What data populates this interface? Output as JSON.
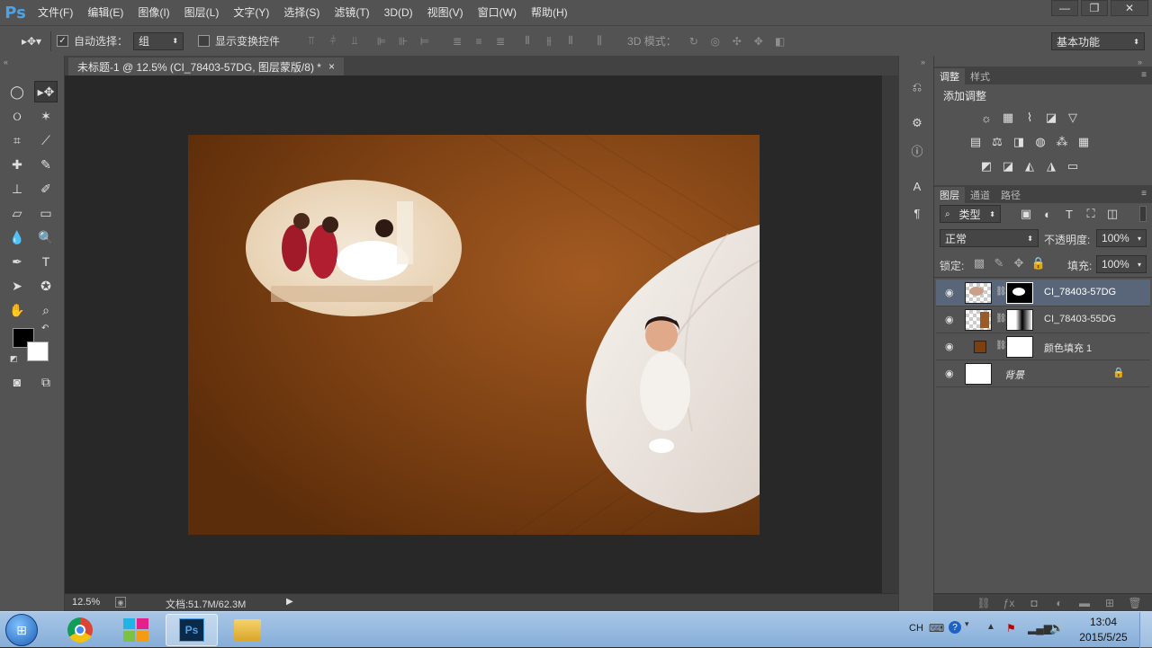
{
  "app": {
    "logo": "Ps"
  },
  "menu": [
    "文件(F)",
    "编辑(E)",
    "图像(I)",
    "图层(L)",
    "文字(Y)",
    "选择(S)",
    "滤镜(T)",
    "3D(D)",
    "视图(V)",
    "窗口(W)",
    "帮助(H)"
  ],
  "window_controls": {
    "minimize": "—",
    "restore": "❐",
    "close": "✕"
  },
  "options": {
    "auto_select_label": "自动选择：",
    "auto_select_value": "组",
    "show_transform_label": "显示变换控件",
    "mode_3d_label": "3D 模式：",
    "workspace": "基本功能"
  },
  "document": {
    "tab_title": "未标题-1 @ 12.5% (CI_78403-57DG, 图层蒙版/8) *",
    "tab_close": "×",
    "canvas_color": "#6e3a10"
  },
  "status": {
    "zoom": "12.5%",
    "doc_size": "文档:51.7M/62.3M"
  },
  "adjust_panel": {
    "tabs": [
      "调整",
      "样式"
    ],
    "title": "添加调整"
  },
  "layers_panel": {
    "tabs": [
      "图层",
      "通道",
      "路径"
    ],
    "filter_kind": "类型",
    "blend_mode": "正常",
    "opacity_label": "不透明度:",
    "opacity_value": "100%",
    "lock_label": "锁定:",
    "fill_label": "填充:",
    "fill_value": "100%",
    "layers": [
      {
        "name": "CI_78403-57DG",
        "selected": true
      },
      {
        "name": "CI_78403-55DG",
        "selected": false
      },
      {
        "name": "颜色填充 1",
        "selected": false
      },
      {
        "name": "背景",
        "selected": false
      }
    ]
  },
  "taskbar": {
    "lang": "CH",
    "time": "13:04",
    "date": "2015/5/25"
  },
  "colors": {
    "panel": "#535353",
    "canvas_bg": "#282828",
    "accent_ps": "#4aa3e8",
    "selected_layer": "#59667a"
  }
}
